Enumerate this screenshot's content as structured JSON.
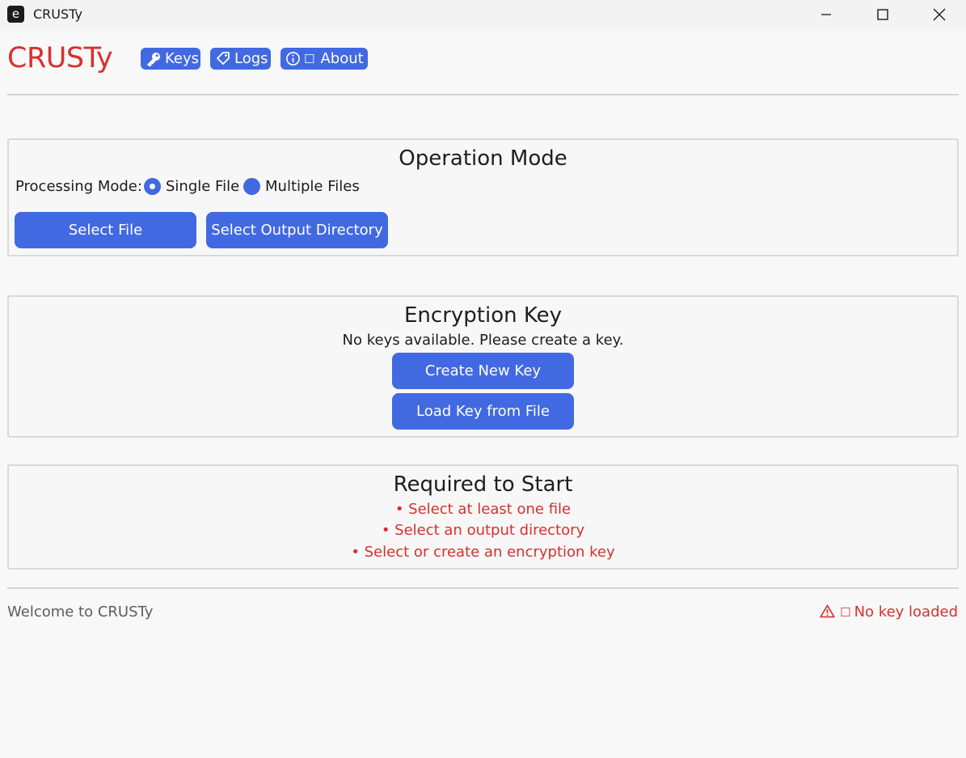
{
  "window": {
    "title": "CRUSTy",
    "app_icon_glyph": "e",
    "controls": [
      "minimize-icon",
      "maximize-icon",
      "close-icon"
    ]
  },
  "header": {
    "brand": "CRUSTy",
    "brand_color": "#d8302e",
    "nav": [
      {
        "label": "Keys",
        "icon": "key-icon"
      },
      {
        "label": "Logs",
        "icon": "tag-icon"
      },
      {
        "label": "About",
        "icon": "info-icon",
        "extra_glyph": "☐"
      }
    ]
  },
  "operation_mode": {
    "title": "Operation Mode",
    "processing_label": "Processing Mode:",
    "options": [
      {
        "label": "Single File",
        "selected": true
      },
      {
        "label": "Multiple Files",
        "selected": false
      }
    ],
    "select_file_label": "Select File",
    "select_output_label": "Select Output Directory"
  },
  "encryption_key": {
    "title": "Encryption Key",
    "message": "No keys available. Please create a key.",
    "create_label": "Create New Key",
    "load_label": "Load Key from File"
  },
  "requirements": {
    "title": "Required to Start",
    "items": [
      "• Select at least one file",
      "• Select an output directory",
      "• Select or create an encryption key"
    ]
  },
  "status": {
    "message": "Welcome to CRUSTy",
    "key_glyph": "☐",
    "key_status": "No key loaded",
    "warning_icon": "warning-icon"
  },
  "colors": {
    "accent": "#4169e1",
    "error": "#d8302e",
    "background": "#f8f8f8"
  }
}
